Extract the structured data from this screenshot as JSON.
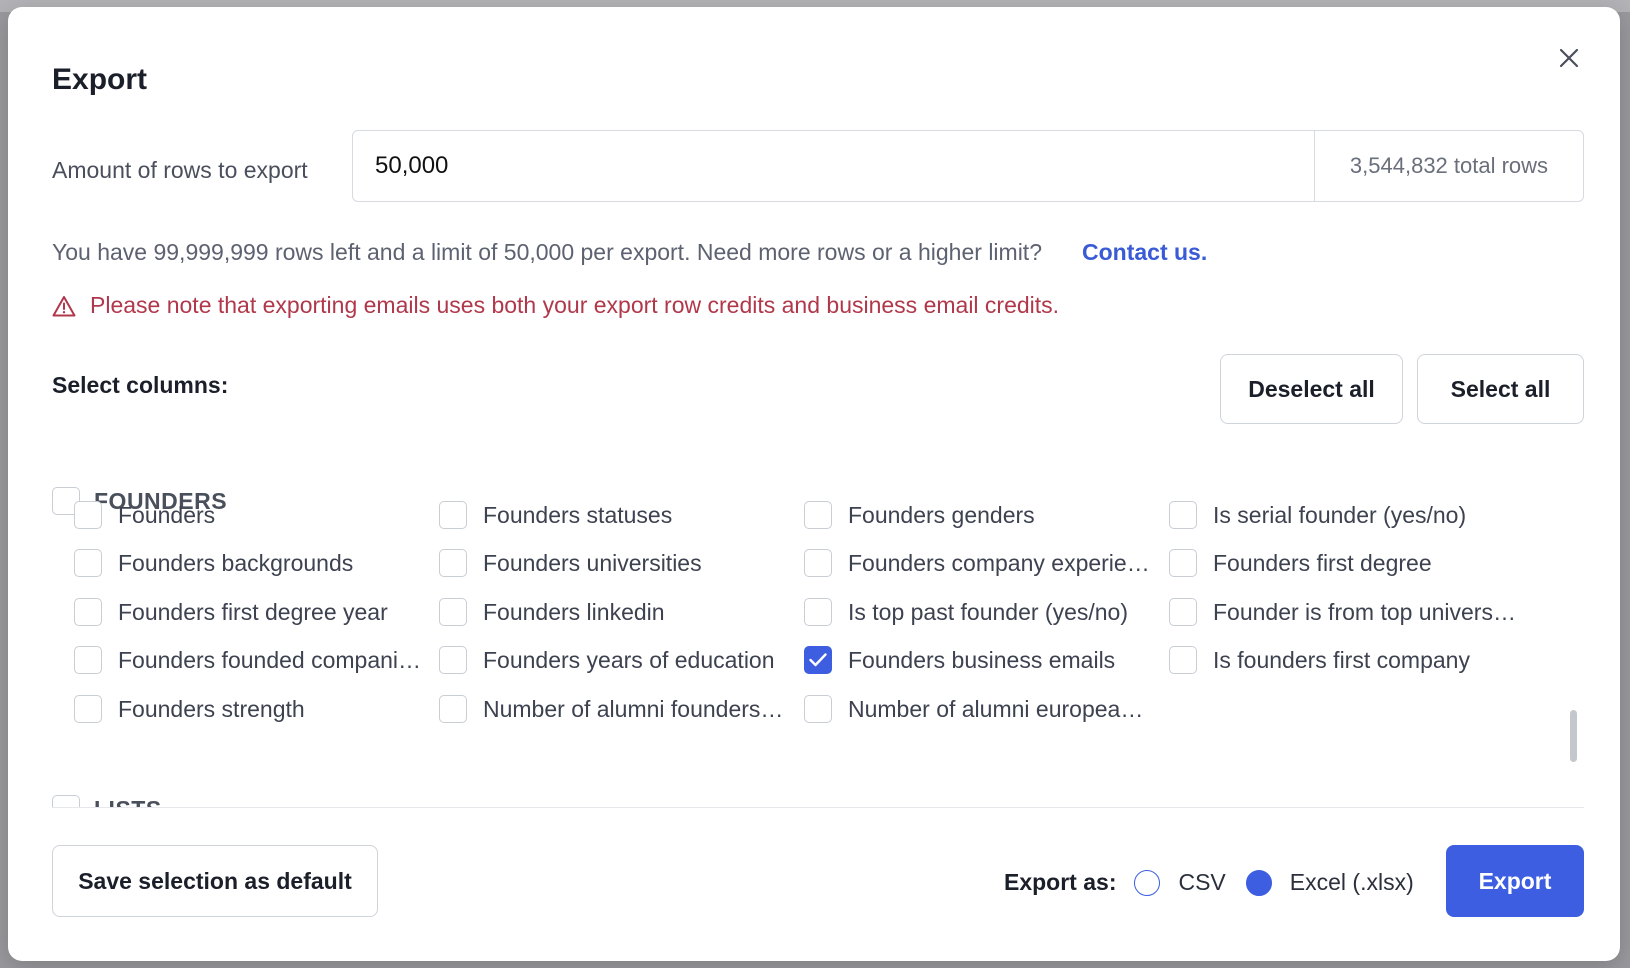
{
  "modal": {
    "title": "Export",
    "close_icon": "close-icon"
  },
  "rows": {
    "label": "Amount of rows to export",
    "value": "50,000",
    "total": "3,544,832 total rows"
  },
  "limit": {
    "text": "You have 99,999,999 rows left and a limit of 50,000 per export. Need more rows or a higher limit?",
    "link": "Contact us."
  },
  "warning": {
    "icon": "warning-triangle-icon",
    "text": "Please note that exporting emails uses both your export row credits and business email credits."
  },
  "columns": {
    "label": "Select columns:",
    "deselect_all": "Deselect all",
    "select_all": "Select all",
    "groups": [
      {
        "name": "FOUNDERS",
        "checked": false,
        "items": [
          {
            "label": "Founders",
            "checked": false
          },
          {
            "label": "Founders statuses",
            "checked": false
          },
          {
            "label": "Founders genders",
            "checked": false
          },
          {
            "label": "Is serial founder (yes/no)",
            "checked": false
          },
          {
            "label": "Founders backgrounds",
            "checked": false
          },
          {
            "label": "Founders universities",
            "checked": false
          },
          {
            "label": "Founders company experie…",
            "checked": false
          },
          {
            "label": "Founders first degree",
            "checked": false
          },
          {
            "label": "Founders first degree year",
            "checked": false
          },
          {
            "label": "Founders linkedin",
            "checked": false
          },
          {
            "label": "Is top past founder (yes/no)",
            "checked": false
          },
          {
            "label": "Founder is from top univers…",
            "checked": false
          },
          {
            "label": "Founders founded compani…",
            "checked": false
          },
          {
            "label": "Founders years of education",
            "checked": false
          },
          {
            "label": "Founders business emails",
            "checked": true
          },
          {
            "label": "Is founders first company",
            "checked": false
          },
          {
            "label": "Founders strength",
            "checked": false
          },
          {
            "label": "Number of alumni founders…",
            "checked": false
          },
          {
            "label": "Number of alumni europea…",
            "checked": false
          }
        ]
      },
      {
        "name": "LISTS",
        "checked": false,
        "items": []
      }
    ]
  },
  "footer": {
    "save_default": "Save selection as default",
    "export_as_label": "Export as:",
    "formats": [
      {
        "label": "CSV",
        "selected": false
      },
      {
        "label": "Excel (.xlsx)",
        "selected": true
      }
    ],
    "export_button": "Export"
  },
  "colors": {
    "accent": "#3d5ee1",
    "warning": "#b0384a",
    "link": "#3a5bd6"
  }
}
